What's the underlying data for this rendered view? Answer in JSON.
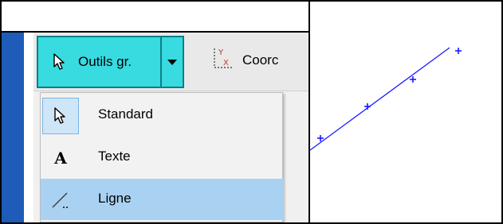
{
  "toolbar": {
    "tools_button_label": "Outils gr.",
    "coord_label": "Coorc",
    "coord_icon_letters": {
      "y": "Y",
      "x": "X"
    }
  },
  "menu": {
    "items": [
      {
        "label": "Standard",
        "icon": "cursor-arrow-icon",
        "state": "hover"
      },
      {
        "label": "Texte",
        "icon": "text-letter-icon",
        "icon_text": "A",
        "state": "normal"
      },
      {
        "label": "Ligne",
        "icon": "line-tool-icon",
        "state": "selected"
      }
    ]
  },
  "colors": {
    "tools_button_bg": "#37dbe0",
    "selected_item_bg": "#a9d2f2",
    "strip_blue": "#1f5bb8",
    "plot_line": "#1a1aff",
    "coord_icon_x": "#e03030"
  }
}
